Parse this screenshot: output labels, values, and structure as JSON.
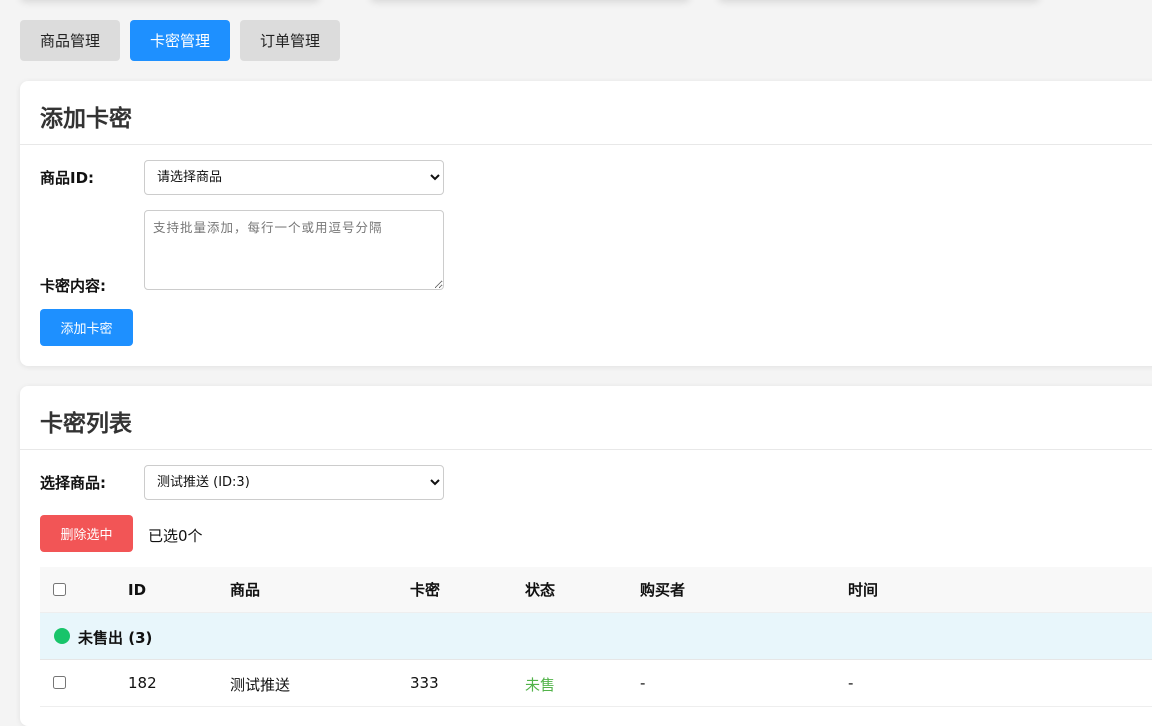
{
  "tabs": [
    {
      "label": "商品管理",
      "active": false
    },
    {
      "label": "卡密管理",
      "active": true
    },
    {
      "label": "订单管理",
      "active": false
    }
  ],
  "add_card": {
    "title": "添加卡密",
    "product_label": "商品ID:",
    "product_select_value": "请选择商品",
    "content_label": "卡密内容:",
    "content_placeholder": "支持批量添加，每行一个或用逗号分隔",
    "submit_label": "添加卡密"
  },
  "list": {
    "title": "卡密列表",
    "filter_label": "选择商品:",
    "filter_value": "测试推送 (ID:3)",
    "delete_label": "删除选中",
    "selected_text": "已选0个",
    "columns": [
      "ID",
      "商品",
      "卡密",
      "状态",
      "购买者",
      "时间"
    ],
    "group_label": "未售出 (3)",
    "rows": [
      {
        "id": "182",
        "product": "测试推送",
        "card": "333",
        "status": "未售",
        "buyer": "-",
        "time": "-"
      }
    ]
  },
  "colors": {
    "accent": "#1e90ff",
    "danger": "#f25556",
    "unsold_dot": "#18c46a",
    "unsold_text": "#52b34a",
    "group_bg": "#e8f6fb"
  }
}
